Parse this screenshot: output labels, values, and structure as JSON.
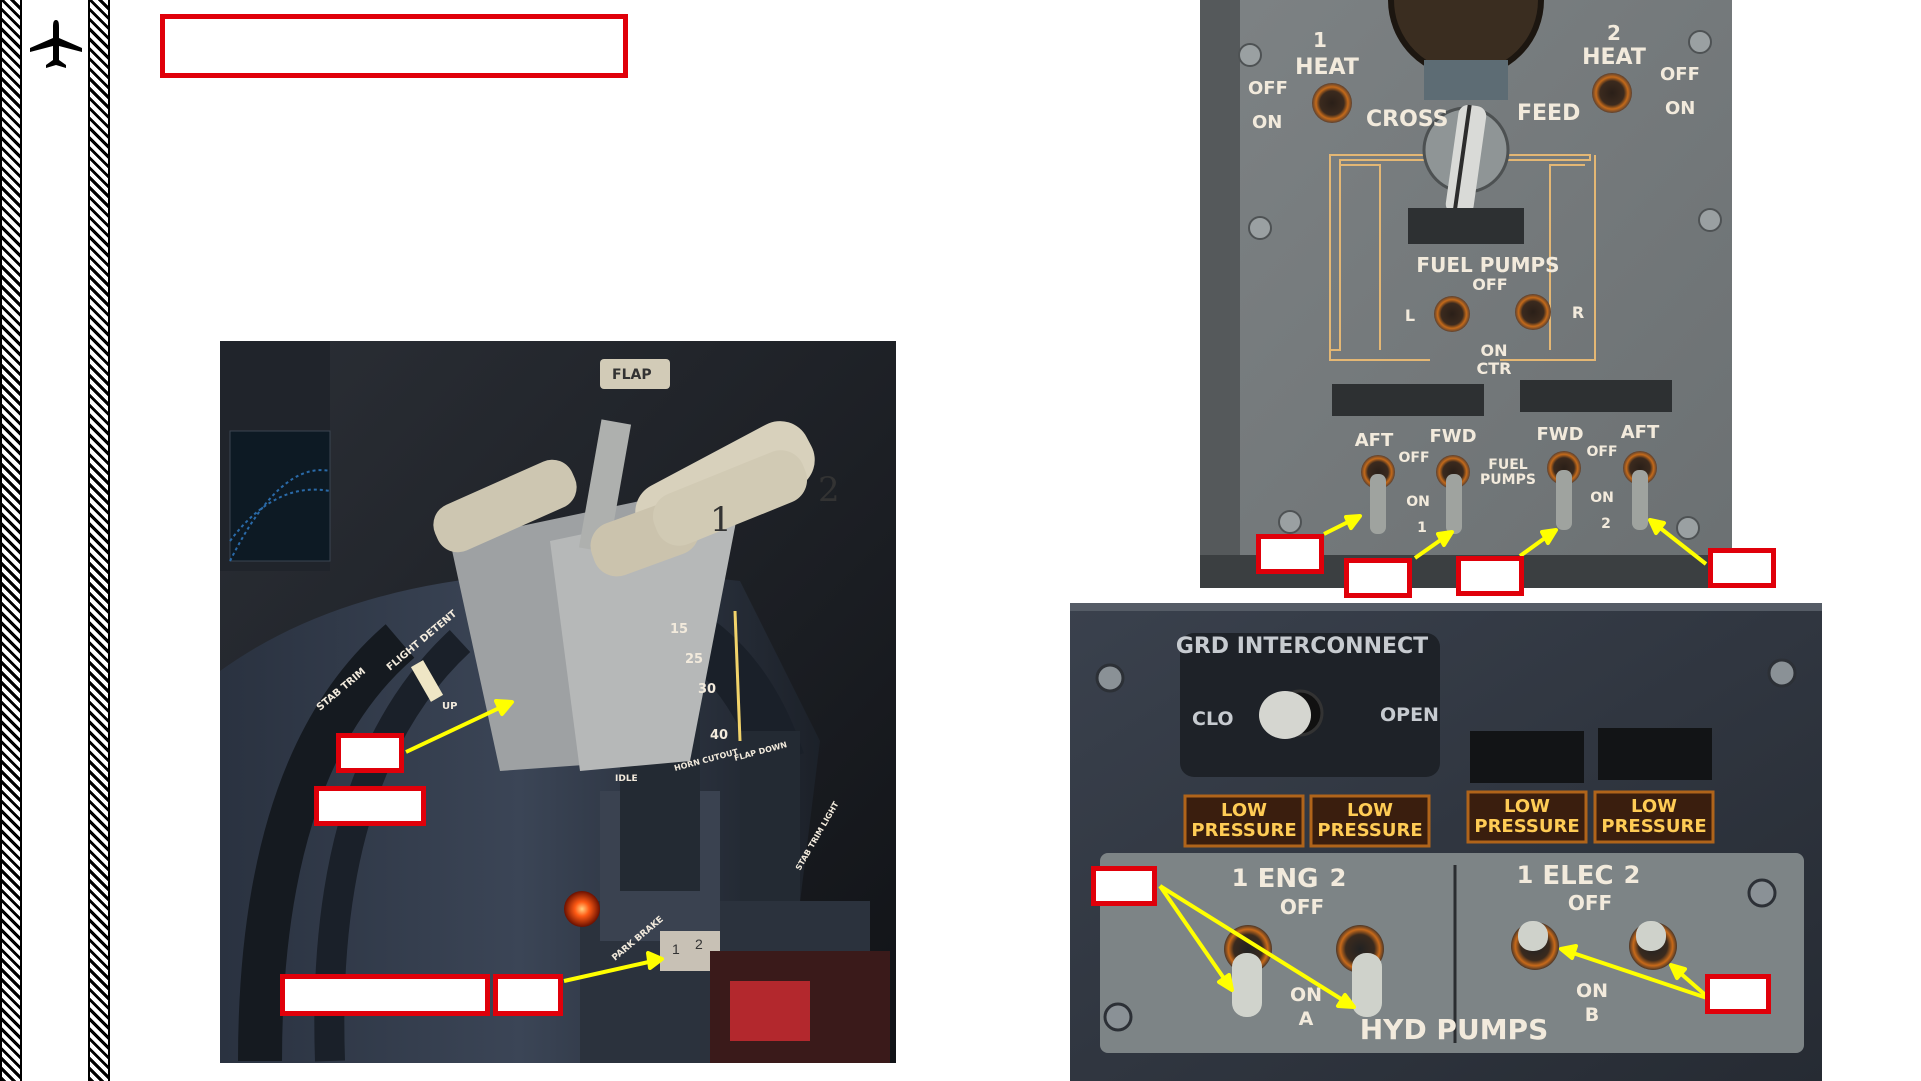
{
  "sidebar": {
    "icon": "airplane-icon"
  },
  "title_box": {
    "text": ""
  },
  "throttle_photo": {
    "lever_numbers": [
      "1",
      "2"
    ],
    "flap_label": "FLAP",
    "flight_detent_label": "FLIGHT DETENT",
    "up_label": "UP",
    "flap_scale": [
      "15",
      "25",
      "30",
      "40"
    ],
    "idle_label": "IDLE",
    "horn_cutout_label": "HORN CUTOUT",
    "flap_down_label": "FLAP DOWN",
    "park_brake_label": "PARK BRAKE",
    "stab_trim_labels": [
      "STAB TRIM",
      "STAB TRIM LIGHT"
    ],
    "fuel_lever_numbers": [
      "1",
      "2"
    ]
  },
  "fuel_panel": {
    "heat1": {
      "num": "1",
      "label": "HEAT",
      "off": "OFF",
      "on": "ON"
    },
    "heat2": {
      "num": "2",
      "label": "HEAT",
      "off": "OFF",
      "on": "ON"
    },
    "crossfeed": [
      "CROSS",
      "FEED"
    ],
    "fuel_pumps_title": "FUEL PUMPS",
    "center_off": "OFF",
    "left": "L",
    "right": "R",
    "on_ctr": [
      "ON",
      "CTR"
    ],
    "aft1": "AFT",
    "fwd1": "FWD",
    "fwd2": "FWD",
    "aft2": "AFT",
    "off_left": "OFF",
    "off_right": "OFF",
    "fuel_pumps_small": [
      "FUEL",
      "PUMPS"
    ],
    "on_left": "ON",
    "on_right": "ON",
    "num_left": "1",
    "num_right": "2"
  },
  "hyd_panel": {
    "grd_interconnect": "GRD INTERCONNECT",
    "close": "CLO",
    "open": "OPEN",
    "low_pressure": [
      [
        "LOW",
        "PRESSURE"
      ],
      [
        "LOW",
        "PRESSURE"
      ],
      [
        "LOW",
        "PRESSURE"
      ],
      [
        "LOW",
        "PRESSURE"
      ]
    ],
    "eng": {
      "left": "1",
      "label": "ENG",
      "right": "2"
    },
    "elec": {
      "left": "1",
      "label": "ELEC",
      "right": "2"
    },
    "off1": "OFF",
    "off2": "OFF",
    "on_a": [
      "ON",
      "A"
    ],
    "on_b": [
      "ON",
      "B"
    ],
    "hyd_pumps": "HYD PUMPS"
  },
  "colors": {
    "callout": "#e0000a",
    "arrow": "#ffff00",
    "panel": "#7e8283",
    "amber": "#ffcc55"
  }
}
